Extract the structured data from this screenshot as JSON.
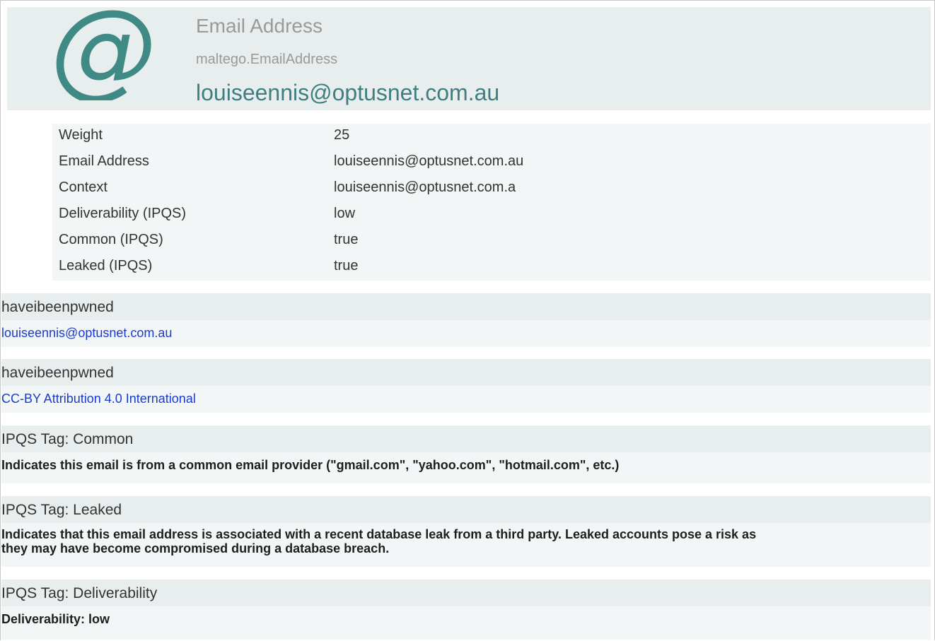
{
  "header": {
    "icon": "at-sign-icon",
    "icon_color": "#3f8a85",
    "type_name": "Email Address",
    "type_id": "maltego.EmailAddress",
    "value": "louiseennis@optusnet.com.au"
  },
  "properties": [
    {
      "key": "Weight",
      "value": "25"
    },
    {
      "key": "Email Address",
      "value": "louiseennis@optusnet.com.au"
    },
    {
      "key": "Context",
      "value": "louiseennis@optusnet.com.a"
    },
    {
      "key": "Deliverability (IPQS)",
      "value": "low"
    },
    {
      "key": "Common (IPQS)",
      "value": "true"
    },
    {
      "key": "Leaked (IPQS)",
      "value": "true"
    }
  ],
  "sections": [
    {
      "title": "haveibeenpwned",
      "body": "louiseennis@optusnet.com.au"
    },
    {
      "title": "haveibeenpwned",
      "body": "CC-BY Attribution 4.0 International"
    },
    {
      "title": "IPQS Tag: Common",
      "body": "Indicates this email is from a common email provider (\"gmail.com\", \"yahoo.com\", \"hotmail.com\", etc.)"
    },
    {
      "title": "IPQS Tag: Leaked",
      "body": "Indicates that this email address is associated with a recent database leak from a third party. Leaked accounts pose a risk as they may have become compromised during a database breach."
    },
    {
      "title": "IPQS Tag: Deliverability",
      "body": "Deliverability: low"
    }
  ],
  "colors": {
    "header_bg": "#e8eeee",
    "body_bg": "#f3f6f6",
    "accent_teal": "#3f7f80",
    "link_blue": "#1a3ccc"
  }
}
